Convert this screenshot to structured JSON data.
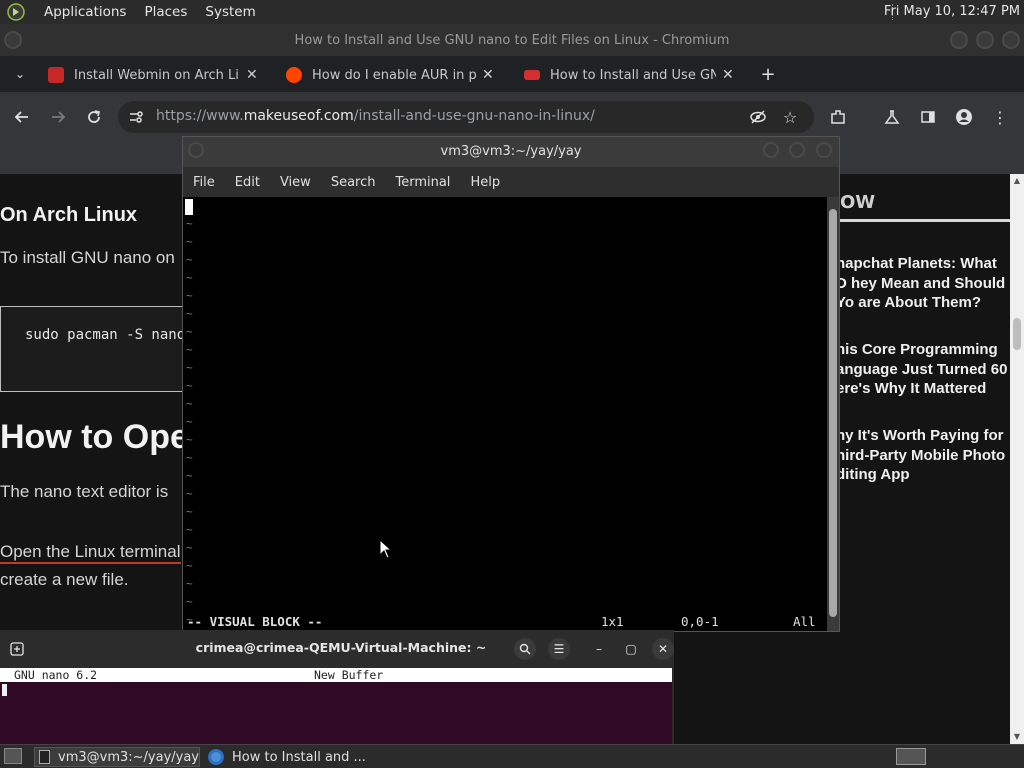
{
  "top_panel": {
    "menus": [
      "Applications",
      "Places",
      "System"
    ],
    "clock": "Fri May 10, 12:47 PM"
  },
  "browser": {
    "window_title": "How to Install and Use GNU nano to Edit Files on Linux - Chromium",
    "tabs": [
      {
        "label": "Install Webmin on Arch Linux",
        "favicon_color": "#c62828"
      },
      {
        "label": "How do I enable AUR in pacman",
        "favicon_color": "#ff4500"
      },
      {
        "label": "How to Install and Use GNU nano",
        "favicon_color": "#d32f2f"
      }
    ],
    "url_prefix": "https://www.",
    "url_host": "makeuseof.com",
    "url_path": "/install-and-use-gnu-nano-in-linux/"
  },
  "page": {
    "heading_arch": "On Arch Linux",
    "para_install": "To install GNU nano on",
    "code": "sudo pacman -S nano",
    "heading_open": "How to Open",
    "para_nano": "The nano text editor is",
    "para_terminal": "Open the Linux terminal",
    "para_create": "create a new file.",
    "sidebar_heading": "OW",
    "sidebar_items": [
      "napchat Planets: What D hey Mean and Should Yo are About Them?",
      "his Core Programming anguage Just Turned 60 ere's Why It Mattered",
      "hy It's Worth Paying for hird-Party Mobile Photo diting App"
    ]
  },
  "terminal": {
    "title": "vm3@vm3:~/yay/yay",
    "menu": [
      "File",
      "Edit",
      "View",
      "Search",
      "Terminal",
      "Help"
    ],
    "tilde_count": 23,
    "status_mode": "-- VISUAL BLOCK --",
    "status_selection": "1x1",
    "status_position": "0,0-1",
    "status_scroll": "All"
  },
  "gnome_terminal": {
    "title": "crimea@crimea-QEMU-Virtual-Machine: ~",
    "nano_version": "GNU nano 6.2",
    "buffer": "New Buffer"
  },
  "taskbar": {
    "tasks": [
      "vm3@vm3:~/yay/yay",
      "How to Install and ..."
    ]
  }
}
